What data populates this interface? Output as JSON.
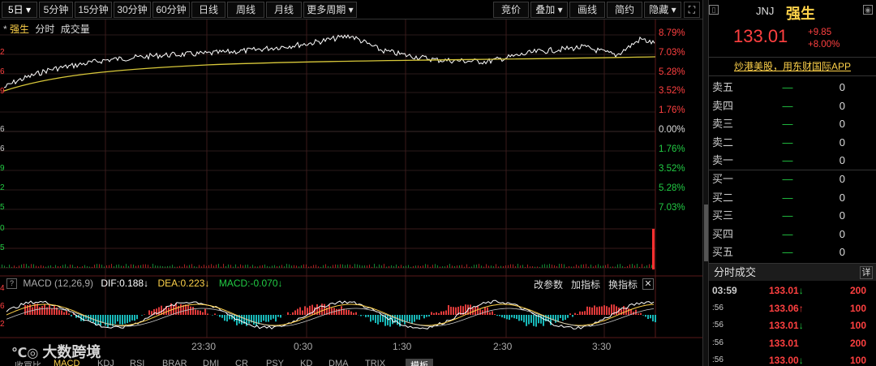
{
  "toolbar": {
    "periods": [
      {
        "label": "5日",
        "dropdown": true,
        "selected": true
      },
      {
        "label": "5分钟"
      },
      {
        "label": "15分钟"
      },
      {
        "label": "30分钟"
      },
      {
        "label": "60分钟"
      },
      {
        "label": "日线"
      },
      {
        "label": "周线"
      },
      {
        "label": "月线"
      },
      {
        "label": "更多周期",
        "dropdown": true
      }
    ],
    "tools": [
      {
        "label": "竞价"
      },
      {
        "label": "叠加",
        "dropdown": true
      },
      {
        "label": "画线"
      },
      {
        "label": "简约"
      },
      {
        "label": "隐藏",
        "dropdown": true
      }
    ],
    "fullscreen_icon": "expand-icon"
  },
  "main_chart": {
    "series_labels": [
      "强生",
      "分时",
      "成交量"
    ],
    "left_ticks": [
      "2",
      "6",
      "9",
      "6",
      "6",
      "9",
      "2",
      "5",
      "0",
      "5"
    ],
    "right_pcts": [
      {
        "text": "8.79%",
        "dir": "up"
      },
      {
        "text": "7.03%",
        "dir": "up"
      },
      {
        "text": "5.28%",
        "dir": "up"
      },
      {
        "text": "3.52%",
        "dir": "up"
      },
      {
        "text": "1.76%",
        "dir": "up"
      },
      {
        "text": "0.00%",
        "dir": "flat"
      },
      {
        "text": "1.76%",
        "dir": "dn"
      },
      {
        "text": "3.52%",
        "dir": "dn"
      },
      {
        "text": "5.28%",
        "dir": "dn"
      },
      {
        "text": "7.03%",
        "dir": "dn"
      }
    ],
    "price_line_color": "#ffffff",
    "avg_line_color": "#d8c83a"
  },
  "macd": {
    "title": "MACD (12,26,9)",
    "dif_label": "DIF:",
    "dif_value": "0.188",
    "dif_arrow": "↓",
    "dea_label": "DEA:",
    "dea_value": "0.223",
    "dea_arrow": "↓",
    "macd_label": "MACD:",
    "macd_value": "-0.070",
    "macd_arrow": "↓",
    "actions": [
      "改参数",
      "加指标",
      "换指标"
    ],
    "close_icon": "close-icon",
    "left_ticks": [
      "4",
      "6",
      "2"
    ]
  },
  "time_axis": [
    "23:30",
    "0:30",
    "1:30",
    "2:30",
    "3:30"
  ],
  "bottom_tabs": [
    "收買比",
    "MACD",
    "KDJ",
    "RSI",
    "BRAR",
    "DMI",
    "CR",
    "PSY",
    "KD",
    "DMA",
    "TRIX",
    "模板"
  ],
  "watermark": "大数跨境",
  "quote": {
    "code": "JNJ",
    "name": "强生",
    "price": "133.01",
    "change": "+9.85",
    "change_pct": "+8.00%",
    "ad_text": "炒港美股，用东财国际APP",
    "asks": [
      {
        "label": "卖五",
        "price": "—",
        "vol": "0"
      },
      {
        "label": "卖四",
        "price": "—",
        "vol": "0"
      },
      {
        "label": "卖三",
        "price": "—",
        "vol": "0"
      },
      {
        "label": "卖二",
        "price": "—",
        "vol": "0"
      },
      {
        "label": "卖一",
        "price": "—",
        "vol": "0"
      }
    ],
    "bids": [
      {
        "label": "买一",
        "price": "—",
        "vol": "0"
      },
      {
        "label": "买二",
        "price": "—",
        "vol": "0"
      },
      {
        "label": "买三",
        "price": "—",
        "vol": "0"
      },
      {
        "label": "买四",
        "price": "—",
        "vol": "0"
      },
      {
        "label": "买五",
        "price": "—",
        "vol": "0"
      }
    ],
    "trades_title": "分时成交",
    "trades_detail": "详",
    "trades": [
      {
        "time": "03:59",
        "price": "133.01",
        "arrow": "↓",
        "vol": "200"
      },
      {
        "time": ":56",
        "price": "133.06",
        "arrow": "↑",
        "vol": "100"
      },
      {
        "time": ":56",
        "price": "133.01",
        "arrow": "↓",
        "vol": "100"
      },
      {
        "time": ":56",
        "price": "133.01",
        "arrow": "",
        "vol": "200"
      },
      {
        "time": ":56",
        "price": "133.00",
        "arrow": "↓",
        "vol": "100"
      }
    ]
  },
  "colors": {
    "up": "#ff4040",
    "down": "#22cc44",
    "accent": "#ffd24a"
  }
}
